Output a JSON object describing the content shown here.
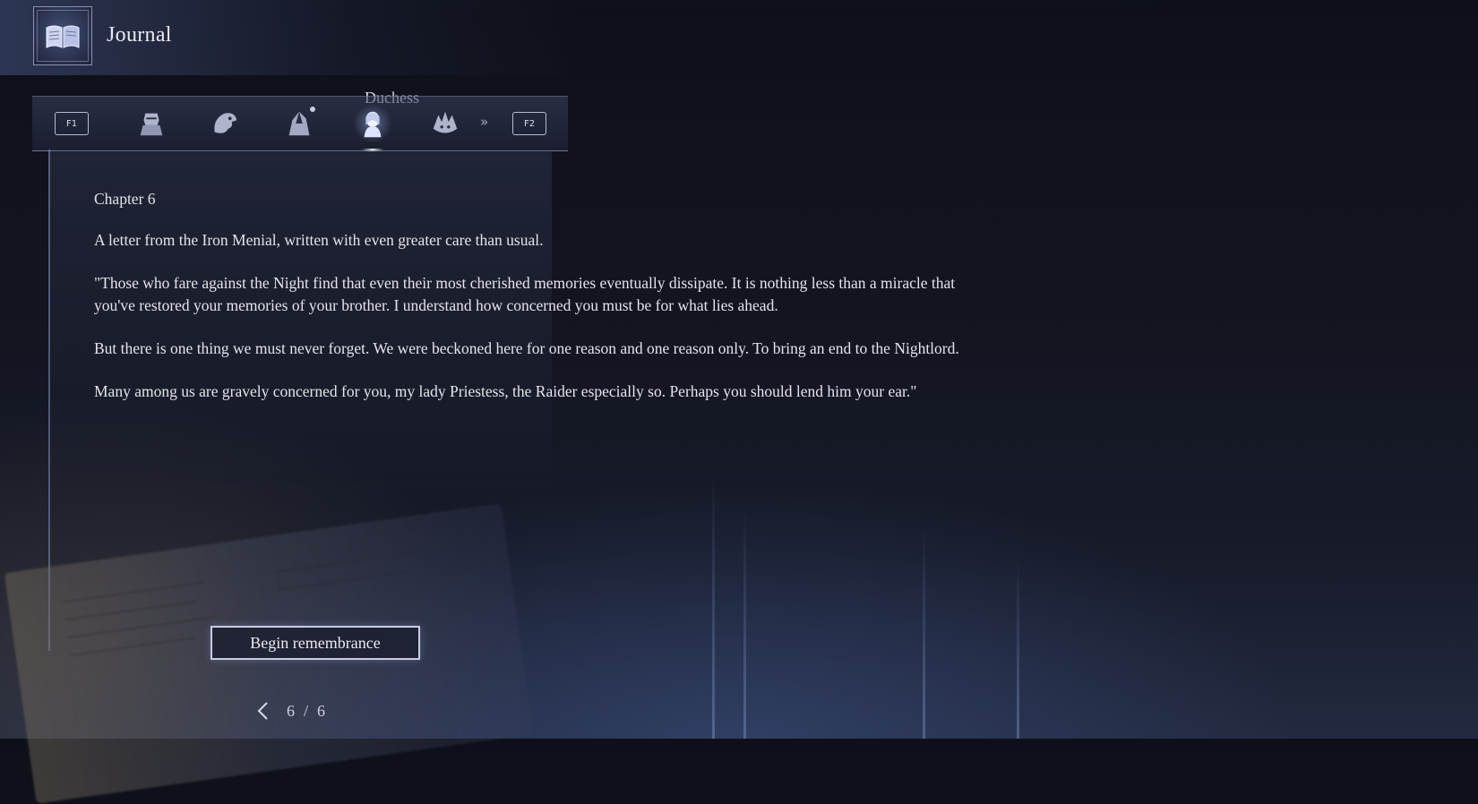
{
  "header": {
    "title": "Journal",
    "icon": "journal-book-icon"
  },
  "tabs": {
    "left_key": "F1",
    "right_key": "F2",
    "active_label": "Duchess",
    "items": [
      {
        "icon": "armored-knight-icon",
        "active": false
      },
      {
        "icon": "eagle-head-icon",
        "active": false
      },
      {
        "icon": "cloaked-figure-icon",
        "active": false,
        "new": true
      },
      {
        "icon": "duchess-portrait-icon",
        "active": true
      },
      {
        "icon": "spiked-beast-icon",
        "active": false
      }
    ],
    "more_icon": "double-chevron-right-icon"
  },
  "entry": {
    "chapter": "Chapter 6",
    "paragraphs": [
      "A letter from the Iron Menial, written with even greater care than usual.",
      "\"Those who fare against the Night find that even their most cherished memories eventually dissipate. It is nothing less than a miracle that you've restored your memories of your brother. I understand how concerned you must be for what lies ahead.",
      "But there is one thing we must never forget. We were beckoned here for one reason and one reason only. To bring an end to the Nightlord.",
      "Many among us are gravely concerned for you, my lady Priestess, the Raider especially so. Perhaps you should lend him your ear.\""
    ]
  },
  "actions": {
    "begin_label": "Begin remembrance"
  },
  "pager": {
    "current": "6",
    "separator": "/",
    "total": "6"
  },
  "colors": {
    "text": "#e6e4ec",
    "accent": "#c9cde2",
    "background": "#12141f"
  }
}
